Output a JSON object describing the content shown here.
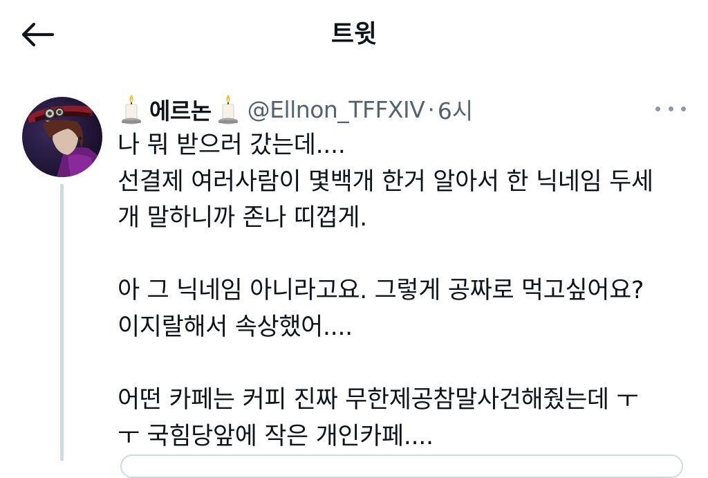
{
  "header": {
    "title": "트윗"
  },
  "tweet": {
    "display_name": "에르논",
    "handle": "@Ellnon_TFFXIV",
    "separator": "·",
    "time": "6시",
    "lines": [
      "나 뭐 받으러 갔는데....",
      "선결제 여러사람이 몇백개 한거 알아서 한 닉네임 두세",
      "개 말하니까 존나 띠껍게.",
      "",
      "아 그 닉네임 아니라고요. 그렇게 공짜로 먹고싶어요?",
      "이지랄해서 속상했어....",
      "",
      "어떤 카페는 커피 진짜 무한제공참말사건해줬는데 ㅜ",
      "ㅜ 국힘당앞에 작은 개인카페...."
    ]
  },
  "icons": {
    "back": "arrow-left-icon",
    "more": "more-horizontal-icon",
    "name_emoji": "candle-icon"
  },
  "colors": {
    "text": "#0f1419",
    "secondary": "#536471",
    "thread_line": "#cfd9de",
    "background": "#ffffff"
  }
}
